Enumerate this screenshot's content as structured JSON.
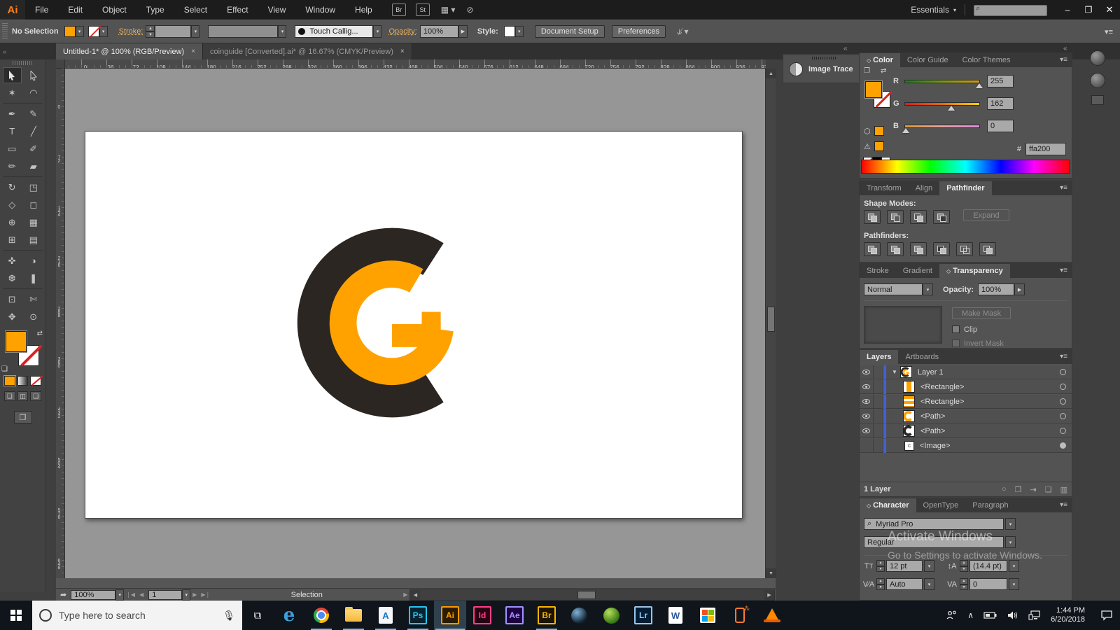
{
  "window": {
    "minimize": "–",
    "restore": "❐",
    "close": "✕"
  },
  "menubar": {
    "app_logo": "Ai",
    "items": [
      "File",
      "Edit",
      "Object",
      "Type",
      "Select",
      "Effect",
      "View",
      "Window",
      "Help"
    ],
    "bridge_btn": "Br",
    "stock_btn": "St",
    "workspace": "Essentials"
  },
  "controlbar": {
    "selection": "No Selection",
    "stroke_label": "Stroke:",
    "brush_preset": "Touch Callig...",
    "opacity_label": "Opacity:",
    "opacity_value": "100%",
    "style_label": "Style:",
    "document_setup": "Document Setup",
    "preferences": "Preferences"
  },
  "tabs": [
    {
      "title": "Untitled-1* @ 100% (RGB/Preview)",
      "close": "×"
    },
    {
      "title": "coinguide [Converted].ai* @ 16.67% (CMYK/Preview)",
      "close": "×"
    }
  ],
  "rulers": {
    "horizontal": [
      "36",
      "0",
      "36",
      "72",
      "108",
      "144",
      "180",
      "216",
      "252",
      "288",
      "324",
      "360",
      "396",
      "432",
      "468",
      "504",
      "540",
      "576",
      "612",
      "648",
      "684",
      "720",
      "756",
      "792",
      "828",
      "864",
      "900",
      "936",
      "972"
    ],
    "vertical": [
      "72",
      "0",
      "72",
      "144",
      "216",
      "288",
      "360",
      "432",
      "504",
      "576",
      "648"
    ]
  },
  "toolbar": {
    "tools": [
      "selection",
      "direct-selection",
      "magic-wand",
      "lasso",
      "pen",
      "curvature",
      "type",
      "line-segment",
      "rectangle",
      "paintbrush",
      "shaper",
      "eraser",
      "rotate",
      "scale",
      "width",
      "free-transform",
      "shape-builder",
      "perspective-grid",
      "mesh",
      "gradient",
      "eyedropper",
      "blend",
      "symbol-sprayer",
      "column-graph",
      "artboard",
      "slice",
      "hand",
      "zoom"
    ]
  },
  "image_trace": {
    "label": "Image Trace"
  },
  "color_panel": {
    "tabs": [
      "Color",
      "Color Guide",
      "Color Themes"
    ],
    "channels": [
      {
        "label": "R",
        "value": "255"
      },
      {
        "label": "G",
        "value": "162"
      },
      {
        "label": "B",
        "value": "0"
      }
    ],
    "hex_prefix": "#",
    "hex_value": "ffa200"
  },
  "pathfinder_panel": {
    "tabs": [
      "Transform",
      "Align",
      "Pathfinder"
    ],
    "shape_modes_label": "Shape Modes:",
    "expand_btn": "Expand",
    "pathfinders_label": "Pathfinders:"
  },
  "transparency_panel": {
    "tabs": [
      "Stroke",
      "Gradient",
      "Transparency"
    ],
    "blend_mode": "Normal",
    "opacity_label": "Opacity:",
    "opacity_value": "100%",
    "make_mask": "Make Mask",
    "clip": "Clip",
    "invert_mask": "Invert Mask"
  },
  "layers_panel": {
    "tabs": [
      "Layers",
      "Artboards"
    ],
    "rows": [
      {
        "label": "Layer 1"
      },
      {
        "label": "<Rectangle>"
      },
      {
        "label": "<Rectangle>"
      },
      {
        "label": "<Path>"
      },
      {
        "label": "<Path>"
      },
      {
        "label": "<Image>"
      }
    ],
    "footer": "1 Layer"
  },
  "character_panel": {
    "tabs": [
      "Character",
      "OpenType",
      "Paragraph"
    ],
    "font_family": "Myriad Pro",
    "font_style": "Regular",
    "font_size": "12 pt",
    "leading": "(14.4 pt)",
    "kerning": "Auto",
    "tracking": "0"
  },
  "statusbar": {
    "zoom": "100%",
    "artboard_nav": "1",
    "status": "Selection"
  },
  "watermark": {
    "line1": "Activate Windows",
    "line2": "Go to Settings to activate Windows."
  },
  "taskbar": {
    "search_placeholder": "Type here to search",
    "icons": {
      "edge": "e",
      "acrobat": "A",
      "photoshop": "Ps",
      "illustrator": "Ai",
      "indesign": "Id",
      "after_effects": "Ae",
      "bridge": "Br",
      "lightroom": "Lr",
      "word": "W"
    },
    "clock_time": "1:44 PM",
    "clock_date": "6/20/2018"
  },
  "colors": {
    "accent": "#ffa200",
    "logo_dark": "#2b2622"
  }
}
